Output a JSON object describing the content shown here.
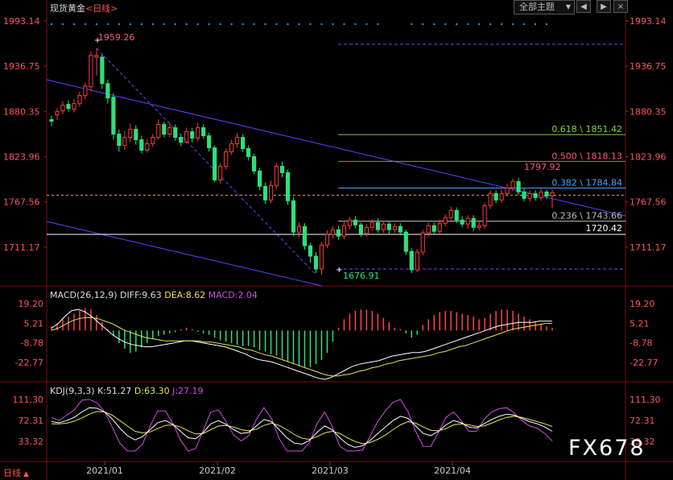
{
  "header": {
    "title": "现货黄金",
    "period_open": "<",
    "period": "日线",
    "period_close": ">",
    "theme_label": "全部主题",
    "theme_arrow": "▼",
    "btn_prev": "◀",
    "btn_next": "▶",
    "btn_close": "×"
  },
  "price_axis": {
    "ticks": [
      "1993.14",
      "1936.75",
      "1880.35",
      "1823.96",
      "1767.56",
      "1711.17"
    ]
  },
  "annotations": {
    "high": "1959.26",
    "low": "1676.91",
    "recent_high": "1797.92",
    "support_level": "1720.42",
    "fib": [
      {
        "label": "0.618 \\ 1851.42",
        "color": "#7fd34a",
        "value": 1851.42
      },
      {
        "label": "0.500 \\ 1818.13",
        "color": "#ff5577",
        "value": 1818.13
      },
      {
        "label": "0.382 \\ 1784.84",
        "color": "#4aa3ff",
        "value": 1784.84
      },
      {
        "label": "0.236 \\ 1743.66",
        "color": "#bbbbbb",
        "value": 1743.66
      }
    ]
  },
  "macd": {
    "label": "MACD(26,12,9)",
    "diff": "DIFF:9.63",
    "dea": "DEA:8.62",
    "macd": "MACD:2.04",
    "ticks": [
      "19.20",
      "5.21",
      "-8.78",
      "-22.77"
    ]
  },
  "kdj": {
    "label": "KDJ(9,3,3)",
    "k": "K:51.27",
    "d": "D:63.30",
    "j": "J:27.19",
    "ticks": [
      "111.30",
      "72.31",
      "33.32"
    ]
  },
  "x_axis": {
    "labels": [
      "2021/01",
      "2021/02",
      "2021/03",
      "2021/04"
    ]
  },
  "footer": {
    "period": "日线",
    "arrow": "▲"
  },
  "watermark": "FX678",
  "colors": {
    "up": "#ff3b3b",
    "down": "#2ee07a",
    "macd_pos": "#ff4444",
    "macd_neg": "#2ee07a",
    "diff": "#ffffff",
    "dea": "#e5e55a",
    "k": "#ffffff",
    "d": "#e5e55a",
    "j": "#d050e0",
    "trend": "#6a3cff",
    "axis_text": "#ff5555"
  },
  "chart_data": {
    "type": "candlestick",
    "title": "现货黄金 日线",
    "ylim": [
      1666,
      2001
    ],
    "candles": [
      [
        1870,
        1868,
        1875,
        1862,
        0
      ],
      [
        1876,
        1880,
        1884,
        1870,
        1
      ],
      [
        1881,
        1888,
        1893,
        1877,
        1
      ],
      [
        1889,
        1884,
        1894,
        1880,
        0
      ],
      [
        1883,
        1890,
        1896,
        1879,
        1
      ],
      [
        1890,
        1900,
        1905,
        1886,
        1
      ],
      [
        1900,
        1912,
        1916,
        1895,
        1
      ],
      [
        1911,
        1950,
        1955,
        1905,
        1
      ],
      [
        1950,
        1948,
        1959,
        1925,
        1
      ],
      [
        1948,
        1915,
        1952,
        1908,
        0
      ],
      [
        1915,
        1897,
        1920,
        1890,
        0
      ],
      [
        1898,
        1852,
        1903,
        1845,
        0
      ],
      [
        1852,
        1838,
        1858,
        1830,
        0
      ],
      [
        1838,
        1848,
        1856,
        1832,
        1
      ],
      [
        1848,
        1858,
        1865,
        1842,
        1
      ],
      [
        1858,
        1845,
        1863,
        1839,
        0
      ],
      [
        1845,
        1832,
        1850,
        1828,
        0
      ],
      [
        1832,
        1840,
        1846,
        1829,
        1
      ],
      [
        1840,
        1848,
        1852,
        1836,
        1
      ],
      [
        1848,
        1864,
        1870,
        1845,
        1
      ],
      [
        1864,
        1852,
        1868,
        1848,
        0
      ],
      [
        1852,
        1860,
        1866,
        1848,
        1
      ],
      [
        1860,
        1848,
        1864,
        1844,
        0
      ],
      [
        1848,
        1842,
        1852,
        1837,
        0
      ],
      [
        1842,
        1855,
        1860,
        1840,
        1
      ],
      [
        1855,
        1847,
        1860,
        1842,
        0
      ],
      [
        1847,
        1860,
        1866,
        1843,
        1
      ],
      [
        1860,
        1850,
        1864,
        1846,
        0
      ],
      [
        1850,
        1835,
        1854,
        1830,
        0
      ],
      [
        1835,
        1795,
        1838,
        1792,
        0
      ],
      [
        1795,
        1812,
        1816,
        1790,
        1
      ],
      [
        1812,
        1830,
        1834,
        1808,
        1
      ],
      [
        1830,
        1840,
        1845,
        1826,
        1
      ],
      [
        1840,
        1848,
        1853,
        1835,
        1
      ],
      [
        1848,
        1834,
        1852,
        1830,
        0
      ],
      [
        1834,
        1824,
        1838,
        1819,
        0
      ],
      [
        1824,
        1806,
        1828,
        1802,
        0
      ],
      [
        1806,
        1787,
        1810,
        1782,
        0
      ],
      [
        1787,
        1770,
        1792,
        1765,
        0
      ],
      [
        1770,
        1788,
        1794,
        1766,
        1
      ],
      [
        1788,
        1812,
        1816,
        1784,
        1
      ],
      [
        1812,
        1804,
        1818,
        1798,
        0
      ],
      [
        1804,
        1769,
        1808,
        1764,
        0
      ],
      [
        1769,
        1730,
        1774,
        1725,
        0
      ],
      [
        1730,
        1737,
        1742,
        1724,
        1
      ],
      [
        1737,
        1713,
        1741,
        1708,
        0
      ],
      [
        1713,
        1700,
        1717,
        1692,
        0
      ],
      [
        1700,
        1684,
        1705,
        1679,
        0
      ],
      [
        1684,
        1714,
        1718,
        1677,
        1
      ],
      [
        1714,
        1727,
        1732,
        1710,
        1
      ],
      [
        1727,
        1733,
        1737,
        1722,
        1
      ],
      [
        1733,
        1725,
        1738,
        1720,
        0
      ],
      [
        1725,
        1738,
        1742,
        1721,
        1
      ],
      [
        1738,
        1745,
        1749,
        1733,
        1
      ],
      [
        1745,
        1739,
        1750,
        1735,
        0
      ],
      [
        1739,
        1728,
        1742,
        1724,
        0
      ],
      [
        1728,
        1736,
        1740,
        1724,
        1
      ],
      [
        1736,
        1742,
        1746,
        1732,
        1
      ],
      [
        1742,
        1733,
        1747,
        1729,
        0
      ],
      [
        1733,
        1740,
        1744,
        1729,
        1
      ],
      [
        1740,
        1733,
        1744,
        1728,
        0
      ],
      [
        1733,
        1737,
        1741,
        1729,
        1
      ],
      [
        1737,
        1730,
        1741,
        1726,
        0
      ],
      [
        1730,
        1706,
        1733,
        1702,
        0
      ],
      [
        1706,
        1683,
        1710,
        1679,
        0
      ],
      [
        1683,
        1705,
        1709,
        1680,
        1
      ],
      [
        1705,
        1729,
        1733,
        1701,
        1
      ],
      [
        1729,
        1738,
        1742,
        1725,
        1
      ],
      [
        1738,
        1731,
        1742,
        1727,
        0
      ],
      [
        1731,
        1741,
        1746,
        1727,
        1
      ],
      [
        1741,
        1748,
        1752,
        1737,
        1
      ],
      [
        1748,
        1757,
        1762,
        1744,
        1
      ],
      [
        1757,
        1745,
        1761,
        1741,
        0
      ],
      [
        1745,
        1740,
        1750,
        1736,
        0
      ],
      [
        1740,
        1747,
        1751,
        1734,
        1
      ],
      [
        1747,
        1736,
        1751,
        1731,
        0
      ],
      [
        1736,
        1738,
        1745,
        1732,
        1
      ],
      [
        1738,
        1763,
        1767,
        1734,
        1
      ],
      [
        1763,
        1778,
        1782,
        1759,
        1
      ],
      [
        1778,
        1770,
        1782,
        1766,
        0
      ],
      [
        1770,
        1778,
        1783,
        1766,
        1
      ],
      [
        1778,
        1785,
        1790,
        1774,
        1
      ],
      [
        1785,
        1793,
        1797,
        1781,
        1
      ],
      [
        1793,
        1780,
        1798,
        1776,
        0
      ],
      [
        1780,
        1772,
        1784,
        1768,
        0
      ],
      [
        1772,
        1778,
        1782,
        1768,
        1
      ],
      [
        1778,
        1773,
        1782,
        1769,
        0
      ],
      [
        1773,
        1780,
        1784,
        1769,
        1
      ],
      [
        1780,
        1775,
        1783,
        1771,
        0
      ],
      [
        1775,
        1779,
        1783,
        1760,
        1
      ]
    ],
    "macd_hist": [
      3,
      5,
      8,
      10,
      12,
      14,
      16,
      15,
      11,
      6,
      1,
      -4,
      -9,
      -13,
      -16,
      -15,
      -12,
      -9,
      -6,
      -4,
      -3,
      -2,
      -1,
      1,
      2,
      1,
      -1,
      -2,
      -3,
      -5,
      -7,
      -8,
      -9,
      -10,
      -11,
      -11,
      -12,
      -14,
      -15,
      -17,
      -18,
      -20,
      -22,
      -24,
      -25,
      -26,
      -26,
      -24,
      -21,
      -16,
      -8,
      2,
      8,
      12,
      14,
      15,
      15,
      14,
      12,
      9,
      6,
      2,
      1,
      -2,
      -5,
      -3,
      4,
      8,
      11,
      13,
      14,
      14,
      13,
      12,
      11,
      10,
      8,
      9,
      12,
      14,
      15,
      15,
      14,
      12,
      10,
      8,
      6,
      5,
      3,
      2
    ],
    "macd_diff": [
      4,
      8,
      14,
      19,
      20,
      18,
      14,
      9,
      4,
      -1,
      -5,
      -8,
      -10,
      -11,
      -12,
      -12,
      -11,
      -10,
      -9,
      -8,
      -7,
      -7,
      -8,
      -9,
      -10,
      -11,
      -12,
      -14,
      -16,
      -18,
      -21,
      -23,
      -24,
      -25,
      -27,
      -29,
      -31,
      -33,
      -35,
      -37,
      -39,
      -40,
      -38,
      -35,
      -32,
      -29,
      -27,
      -26,
      -25,
      -24,
      -22,
      -20,
      -19,
      -18,
      -17,
      -17,
      -16,
      -14,
      -12,
      -10,
      -8,
      -6,
      -4,
      -2,
      0,
      2,
      4,
      6,
      7,
      8,
      9,
      9,
      9,
      10,
      10,
      10
    ],
    "macd_dea": [
      2,
      4,
      7,
      10,
      12,
      13,
      13,
      12,
      10,
      8,
      5,
      2,
      0,
      -2,
      -4,
      -5,
      -6,
      -7,
      -7,
      -7,
      -7,
      -7,
      -7,
      -8,
      -8,
      -9,
      -10,
      -11,
      -12,
      -14,
      -15,
      -17,
      -19,
      -20,
      -22,
      -24,
      -26,
      -28,
      -30,
      -32,
      -34,
      -36,
      -37,
      -37,
      -36,
      -35,
      -33,
      -32,
      -30,
      -29,
      -27,
      -26,
      -24,
      -23,
      -22,
      -21,
      -20,
      -19,
      -17,
      -16,
      -14,
      -12,
      -11,
      -9,
      -7,
      -5,
      -3,
      -1,
      1,
      3,
      4,
      5,
      6,
      7,
      8,
      8
    ],
    "kdj_k": [
      70,
      68,
      72,
      78,
      88,
      96,
      95,
      88,
      75,
      58,
      44,
      36,
      42,
      55,
      68,
      72,
      65,
      52,
      40,
      38,
      50,
      66,
      72,
      65,
      55,
      48,
      50,
      62,
      74,
      70,
      55,
      40,
      30,
      28,
      35,
      50,
      62,
      55,
      40,
      28,
      22,
      25,
      35,
      48,
      60,
      72,
      80,
      76,
      62,
      48,
      44,
      52,
      64,
      72,
      68,
      60,
      58,
      66,
      74,
      80,
      84,
      82,
      76,
      70,
      66,
      60,
      52
    ],
    "kdj_d": [
      66,
      66,
      67,
      71,
      77,
      84,
      89,
      88,
      82,
      72,
      62,
      52,
      49,
      51,
      57,
      63,
      64,
      60,
      53,
      47,
      48,
      55,
      62,
      63,
      60,
      55,
      53,
      56,
      63,
      67,
      63,
      55,
      46,
      39,
      37,
      42,
      49,
      52,
      48,
      40,
      33,
      29,
      31,
      37,
      45,
      55,
      64,
      70,
      67,
      60,
      54,
      53,
      57,
      64,
      66,
      64,
      61,
      62,
      67,
      73,
      78,
      80,
      78,
      74,
      70,
      66,
      61
    ],
    "kdj_j": [
      78,
      72,
      82,
      92,
      110,
      118,
      105,
      88,
      60,
      30,
      8,
      4,
      28,
      62,
      90,
      90,
      67,
      36,
      14,
      20,
      54,
      88,
      92,
      70,
      45,
      34,
      44,
      74,
      96,
      76,
      39,
      10,
      0,
      6,
      31,
      66,
      88,
      61,
      24,
      4,
      0,
      17,
      43,
      70,
      90,
      106,
      112,
      88,
      52,
      24,
      24,
      50,
      78,
      88,
      72,
      52,
      52,
      74,
      88,
      94,
      96,
      86,
      72,
      62,
      58,
      48,
      34
    ]
  }
}
